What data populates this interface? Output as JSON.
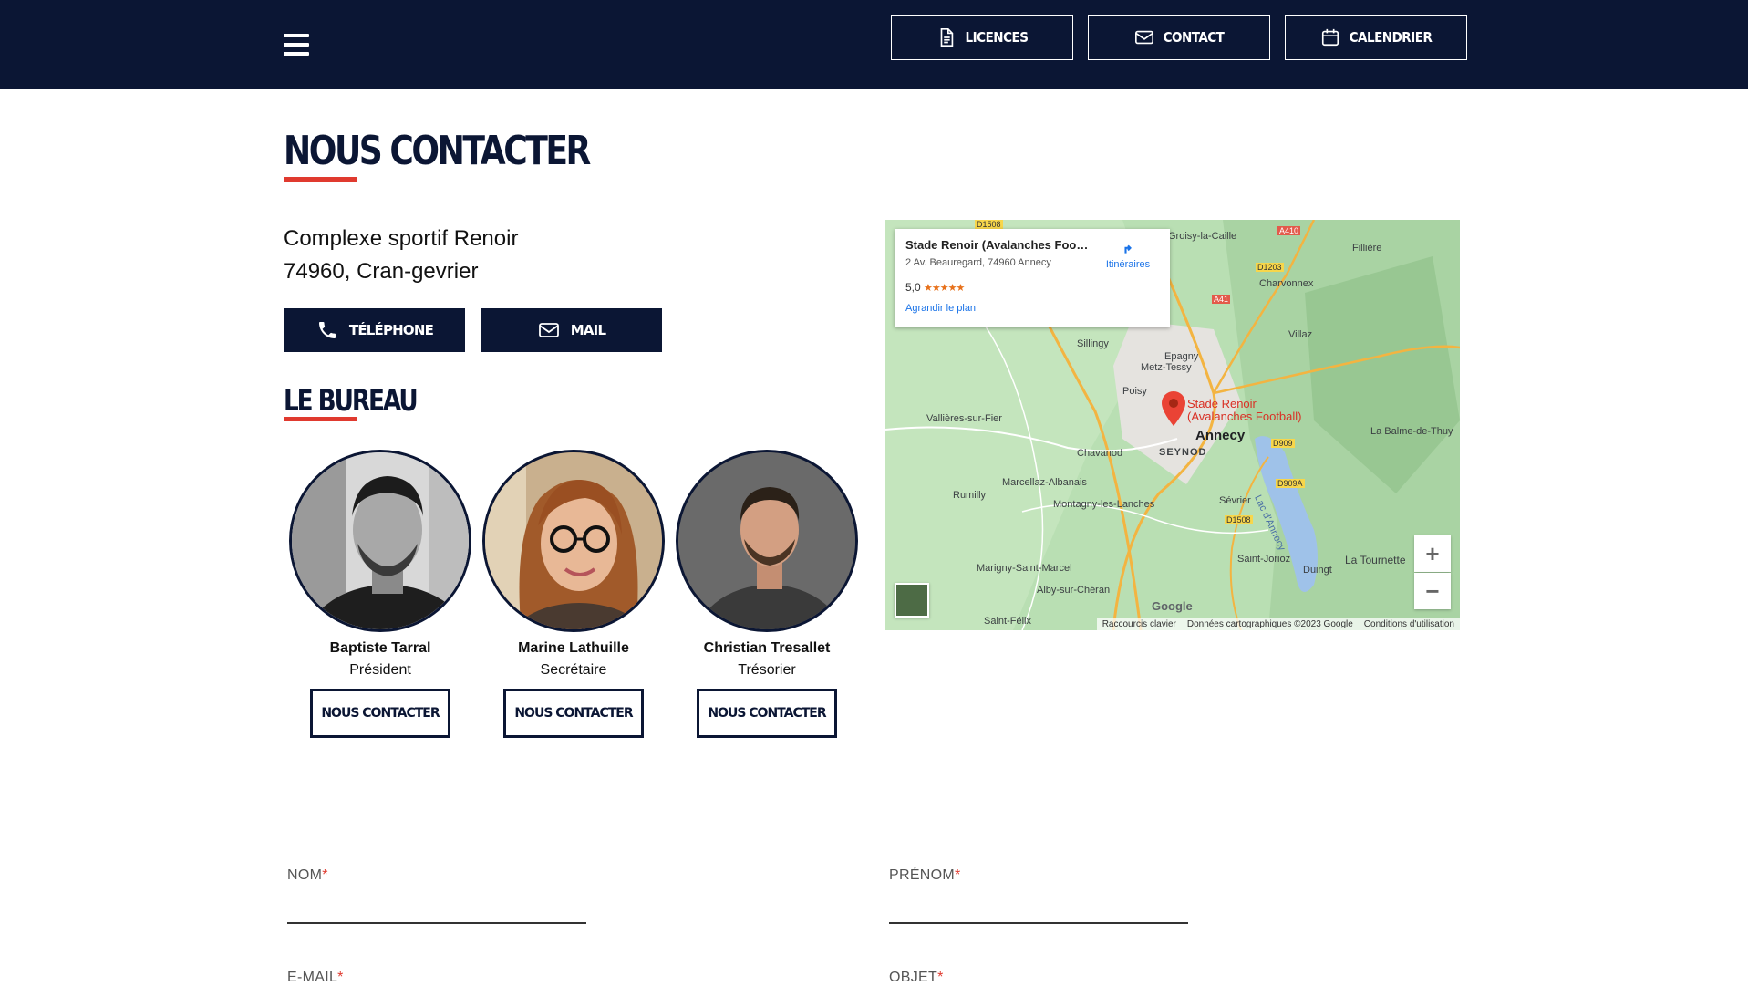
{
  "header": {
    "menu_label": "Menu",
    "nav": [
      {
        "label": "LICENCES",
        "icon": "document-icon"
      },
      {
        "label": "CONTACT",
        "icon": "envelope-icon"
      },
      {
        "label": "CALENDRIER",
        "icon": "calendar-icon"
      }
    ]
  },
  "contact": {
    "title": "NOUS CONTACTER",
    "address_line1": "Complexe sportif Renoir",
    "address_line2": "74960, Cran-gevrier",
    "phone_label": "TÉLÉPHONE",
    "mail_label": "MAIL"
  },
  "bureau": {
    "title": "LE BUREAU",
    "members": [
      {
        "name": "Baptiste Tarral",
        "role": "Président",
        "button": "NOUS CONTACTER"
      },
      {
        "name": "Marine Lathuille",
        "role": "Secrétaire",
        "button": "NOUS CONTACTER"
      },
      {
        "name": "Christian Tresallet",
        "role": "Trésorier",
        "button": "NOUS CONTACTER"
      }
    ]
  },
  "map": {
    "place_name": "Stade Renoir (Avalanches Foo…",
    "place_address": "2 Av. Beauregard, 74960 Annecy",
    "rating": "5,0",
    "stars": "★★★★★",
    "enlarge_link": "Agrandir le plan",
    "directions_label": "Itinéraires",
    "marker_label_1": "Stade Renoir",
    "marker_label_2": "(Avalanches Football)",
    "zoom_in": "+",
    "zoom_out": "−",
    "footer": [
      "Raccourcis clavier",
      "Données cartographiques ©2023 Google",
      "Conditions d'utilisation"
    ],
    "google_logo": "Google",
    "places": [
      "Annecy",
      "SEYNOD",
      "Sillingy",
      "Epagny",
      "Metz-Tessy",
      "Poisy",
      "Vallières-sur-Fier",
      "Chavanod",
      "Marcellaz-Albanais",
      "Rumilly",
      "Montagny-les-Lanches",
      "Sévrier",
      "Saint-Jorioz",
      "Duingt",
      "La Tournette",
      "Marigny-Saint-Marcel",
      "Alby-sur-Chéran",
      "Saint-Félix",
      "Charvonnex",
      "Villaz",
      "Fillière",
      "La Balme-de-Thuy",
      "Lac d'Annecy",
      "Groisy-la-Caille"
    ],
    "roads": [
      "D1508",
      "A410",
      "D1203",
      "A41",
      "D909",
      "D909A",
      "D1508"
    ]
  },
  "form": {
    "nom_label": "NOM",
    "prenom_label": "PRÉNOM",
    "email_label": "E-MAIL",
    "objet_label": "OBJET",
    "required_mark": "*"
  },
  "colors": {
    "navy": "#0b1634",
    "accent_red": "#e03a2f"
  }
}
